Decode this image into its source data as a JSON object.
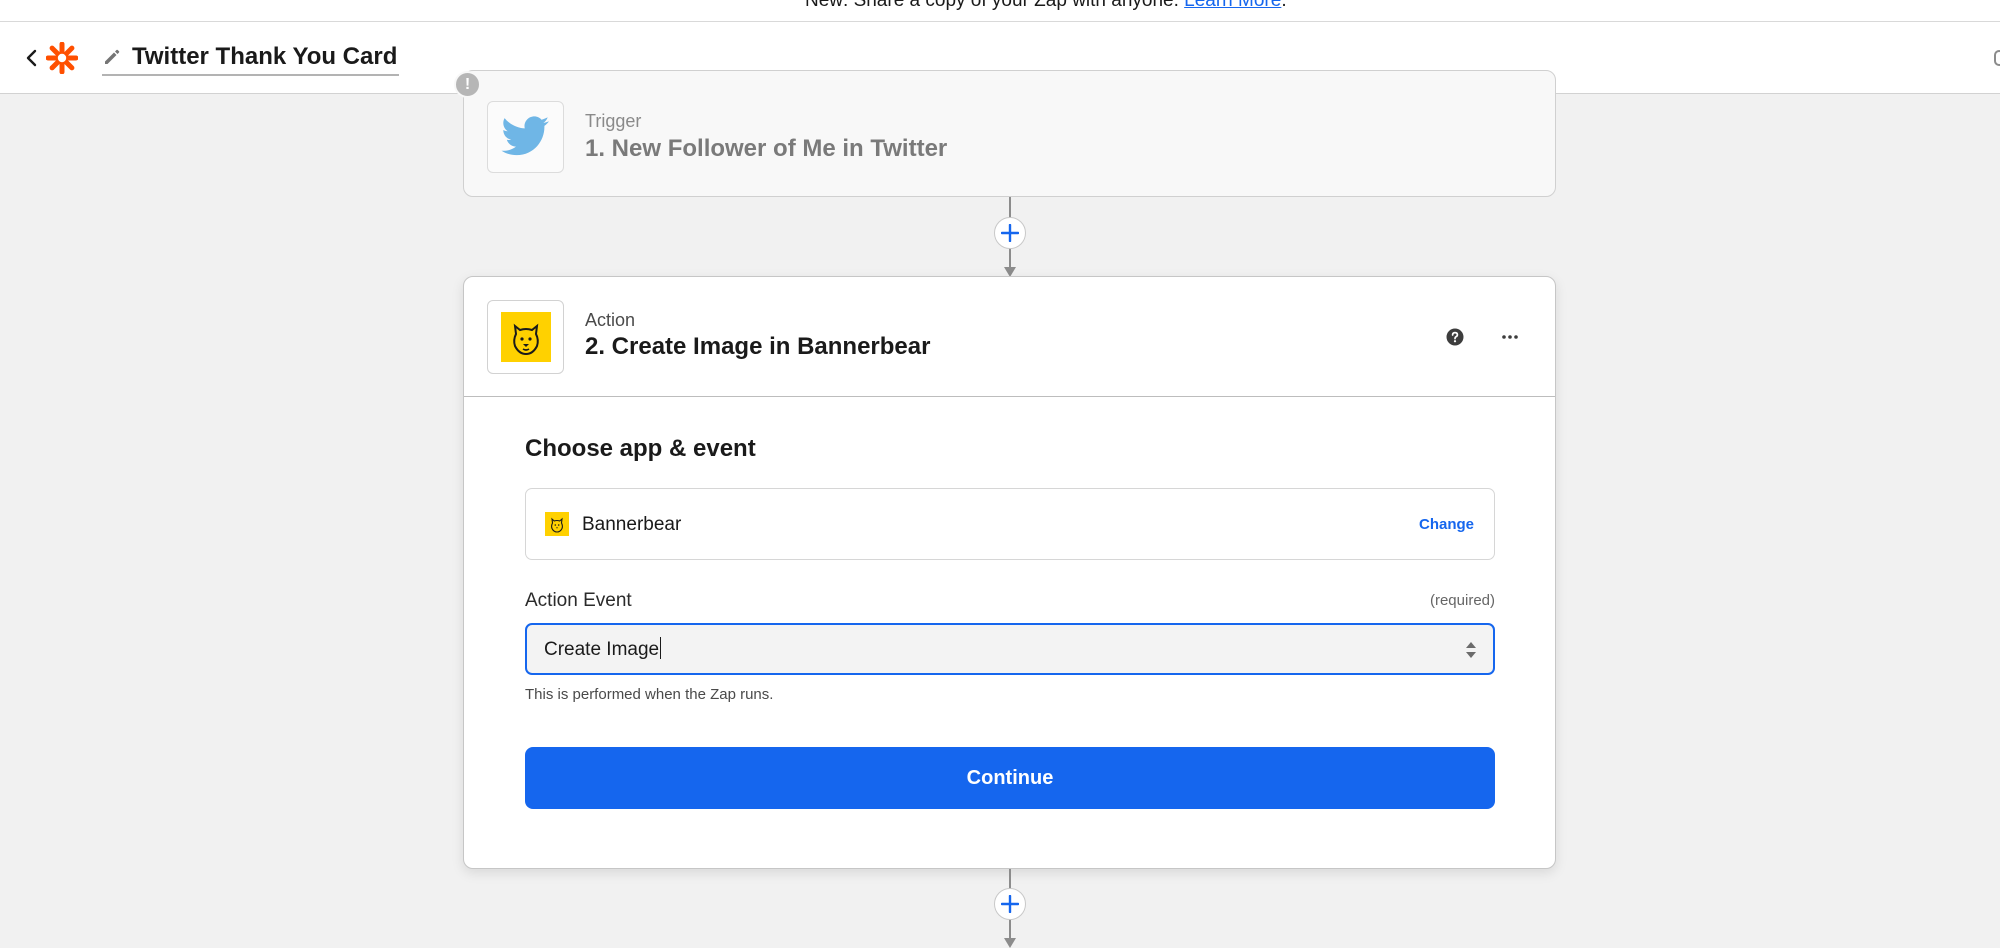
{
  "banner": {
    "text": "New: Share a copy of your Zap with anyone.",
    "link": "Learn More",
    "suffix": "."
  },
  "header": {
    "back_icon": "chevron-left-icon",
    "logo_icon": "zapier-asterisk-logo",
    "edit_icon": "pencil-icon",
    "zap_title": "Twitter Thank You Card"
  },
  "trigger": {
    "kind_label": "Trigger",
    "step_title": "1. New Follower of Me in Twitter",
    "app_icon": "twitter-bird-icon",
    "badge": "!"
  },
  "action": {
    "kind_label": "Action",
    "step_title": "2. Create Image in Bannerbear",
    "app_icon": "bannerbear-icon",
    "help_icon": "question-circle-icon",
    "more_icon": "ellipsis-icon",
    "section_title": "Choose app & event",
    "app": {
      "name": "Bannerbear",
      "change_label": "Change"
    },
    "event_field": {
      "label": "Action Event",
      "required_text": "(required)",
      "value": "Create Image",
      "help_text": "This is performed when the Zap runs."
    },
    "continue_label": "Continue"
  },
  "colors": {
    "accent": "#1566ee",
    "zapier_orange": "#ff4f00",
    "bannerbear_yellow": "#ffd100",
    "twitter_blue": "#6fb6e6"
  }
}
